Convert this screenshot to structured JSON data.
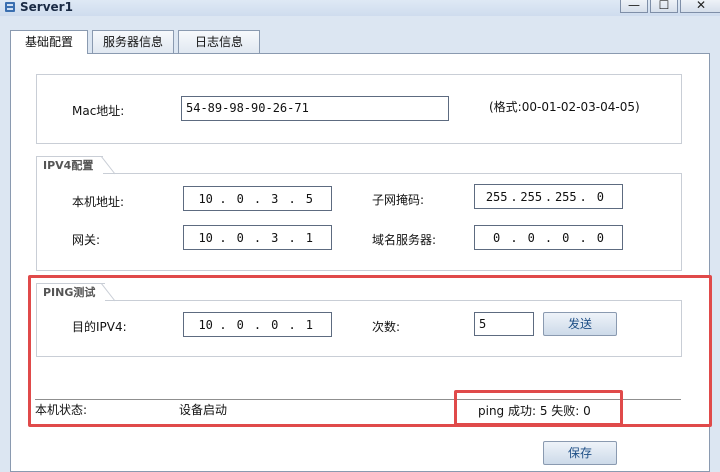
{
  "window": {
    "title": "Server1",
    "minimize": "—",
    "maximize": "☐",
    "close": "✕"
  },
  "tabs": [
    {
      "label": "基础配置",
      "active": true
    },
    {
      "label": "服务器信息",
      "active": false
    },
    {
      "label": "日志信息",
      "active": false
    }
  ],
  "mac": {
    "label": "Mac地址:",
    "value": "54-89-98-90-26-71",
    "format_hint": "(格式:00-01-02-03-04-05)"
  },
  "ipv4": {
    "legend": "IPV4配置",
    "local_ip": {
      "label": "本机地址:",
      "octets": [
        "10",
        "0",
        "3",
        "5"
      ]
    },
    "subnet": {
      "label": "子网掩码:",
      "octets": [
        "255",
        "255",
        "255",
        "0"
      ]
    },
    "gateway": {
      "label": "网关:",
      "octets": [
        "10",
        "0",
        "3",
        "1"
      ]
    },
    "dns": {
      "label": "域名服务器:",
      "octets": [
        "0",
        "0",
        "0",
        "0"
      ]
    }
  },
  "ping": {
    "legend": "PING测试",
    "target": {
      "label": "目的IPV4:",
      "octets": [
        "10",
        "0",
        "0",
        "1"
      ]
    },
    "count": {
      "label": "次数:",
      "value": "5"
    },
    "send_label": "发送"
  },
  "status": {
    "label": "本机状态:",
    "value": "设备启动",
    "ping_result": "ping 成功: 5   失败: 0"
  },
  "save_label": "保存",
  "colors": {
    "highlight": "#e04a4a",
    "titlebar": "#dfe9f5",
    "button_text": "#1f4f86"
  }
}
